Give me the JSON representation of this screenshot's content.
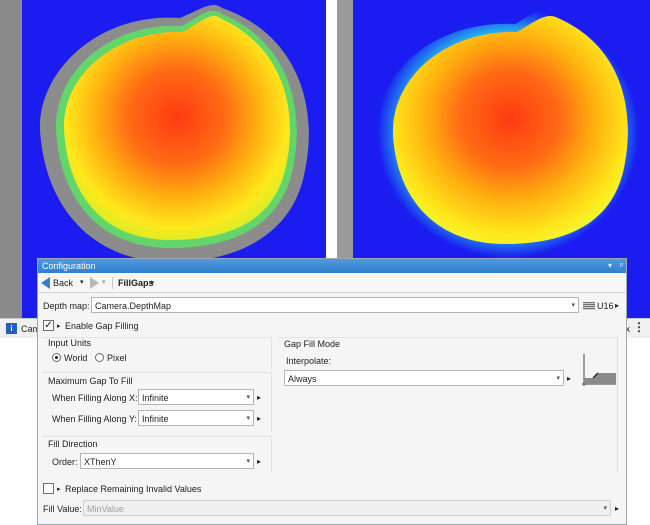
{
  "viewers": {
    "left_status": "Cam",
    "right_status": "ix"
  },
  "config": {
    "title": "Configuration",
    "nav": {
      "back_label": "Back",
      "breadcrumb": "FillGaps"
    },
    "depth_map": {
      "label": "Depth map:",
      "value": "Camera.DepthMap",
      "type": "U16"
    },
    "enable_gap_filling": {
      "label": "Enable Gap Filling",
      "checked": true
    },
    "input_units": {
      "title": "Input Units",
      "options": [
        "World",
        "Pixel"
      ],
      "selected": "World"
    },
    "max_gap": {
      "title": "Maximum Gap To Fill",
      "x_label": "When Filling Along X:",
      "x_value": "Infinite",
      "y_label": "When Filling Along Y:",
      "y_value": "Infinite"
    },
    "fill_direction": {
      "title": "Fill Direction",
      "order_label": "Order:",
      "order_value": "XThenY"
    },
    "gap_fill_mode": {
      "title": "Gap Fill Mode",
      "interpolate_label": "Interpolate:",
      "interpolate_value": "Always"
    },
    "replace_invalid": {
      "label": "Replace Remaining Invalid Values",
      "checked": false
    },
    "fill_value": {
      "label": "Fill Value:",
      "value": "MinValue"
    }
  },
  "icons": {
    "back": "back-arrow-icon",
    "forward": "forward-arrow-icon",
    "unit": "image-type-icon",
    "profile": "interpolation-profile-icon"
  }
}
